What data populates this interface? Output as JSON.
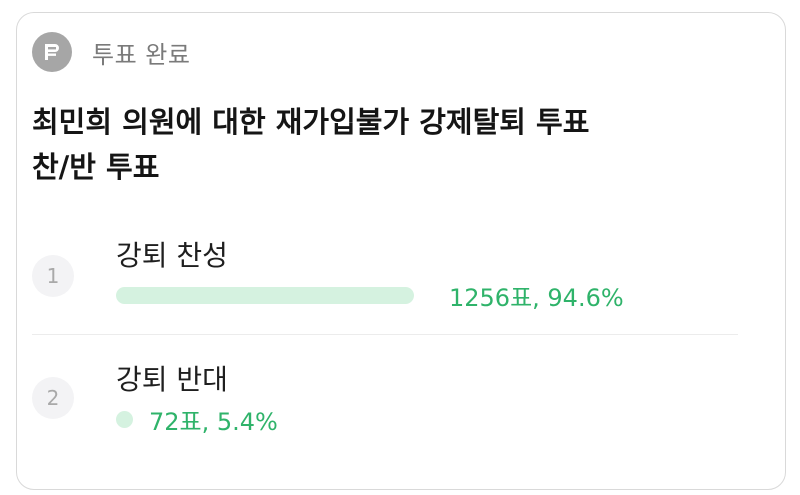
{
  "poll": {
    "status": "투표 완료",
    "icon": "ballot-icon",
    "question_line1": "최민희 의원에 대한 재가입불가 강제탈퇴 투표",
    "question_line2": "찬/반 투표",
    "accent_color": "#2fb36a",
    "bar_color": "#d5f2e0",
    "options": [
      {
        "number": "1",
        "label": "강퇴 찬성",
        "result": "1256표, 94.6%",
        "fraction": 0.946
      },
      {
        "number": "2",
        "label": "강퇴 반대",
        "result": "72표, 5.4%",
        "fraction": 0.054
      }
    ]
  }
}
